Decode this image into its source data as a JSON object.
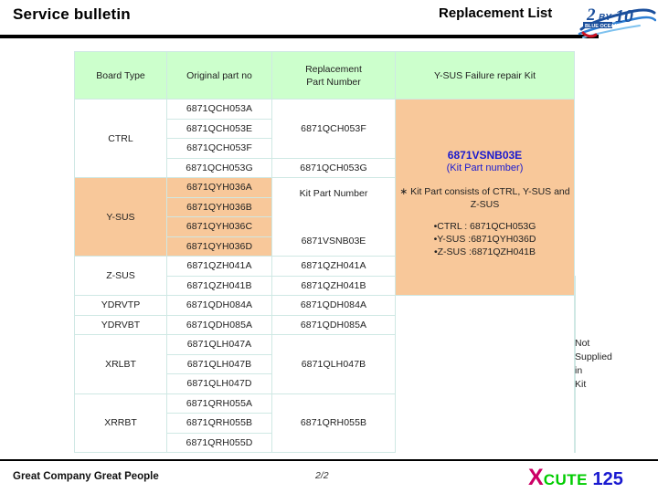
{
  "header": {
    "title": "Service bulletin",
    "subtitle": "Replacement List",
    "logo": {
      "number": "2",
      "by": "BY",
      "ten": "10",
      "tagline": "BLUE OCEAN"
    }
  },
  "table": {
    "columns": [
      "Board Type",
      "Original part no",
      "Replacement\nPart Number",
      "Y-SUS Failure repair Kit"
    ],
    "col_board_type": "Board Type",
    "col_original": "Original part no",
    "col_replacement_l1": "Replacement",
    "col_replacement_l2": "Part Number",
    "col_kit": "Y-SUS Failure repair Kit",
    "groups": [
      {
        "board_type": "CTRL",
        "highlight": false,
        "rows": [
          {
            "original": "6871QCH053A"
          },
          {
            "original": "6871QCH053E"
          },
          {
            "original": "6871QCH053F"
          },
          {
            "original": "6871QCH053G"
          }
        ],
        "replacements": [
          {
            "value": "6871QCH053F",
            "span": 3
          },
          {
            "value": "6871QCH053G",
            "span": 1
          }
        ]
      },
      {
        "board_type": "Y-SUS",
        "highlight": true,
        "rows": [
          {
            "original": "6871QYH036A"
          },
          {
            "original": "6871QYH036B"
          },
          {
            "original": "6871QYH036C"
          },
          {
            "original": "6871QYH036D"
          }
        ],
        "kit_label": "Kit Part Number",
        "kit_value": "6871VSNB03E"
      },
      {
        "board_type": "Z-SUS",
        "highlight": false,
        "rows": [
          {
            "original": "6871QZH041A",
            "replacement": "6871QZH041A"
          },
          {
            "original": "6871QZH041B",
            "replacement": "6871QZH041B"
          }
        ]
      },
      {
        "board_type": "YDRVTP",
        "highlight": false,
        "rows": [
          {
            "original": "6871QDH084A",
            "replacement": "6871QDH084A"
          }
        ]
      },
      {
        "board_type": "YDRVBT",
        "highlight": false,
        "rows": [
          {
            "original": "6871QDH085A",
            "replacement": "6871QDH085A"
          }
        ]
      },
      {
        "board_type": "XRLBT",
        "highlight": false,
        "rows": [
          {
            "original": "6871QLH047A"
          },
          {
            "original": "6871QLH047B"
          },
          {
            "original": "6871QLH047D"
          }
        ],
        "replacements": [
          {
            "value": "6871QLH047B",
            "span": 3
          }
        ]
      },
      {
        "board_type": "XRRBT",
        "highlight": false,
        "rows": [
          {
            "original": "6871QRH055A"
          },
          {
            "original": "6871QRH055B"
          },
          {
            "original": "6871QRH055D"
          }
        ],
        "replacements": [
          {
            "value": "6871QRH055B",
            "span": 3
          }
        ]
      }
    ],
    "kit_panel": {
      "kit_number": "6871VSNB03E",
      "kit_number_sub": "(Kit Part number)",
      "consists_note": "∗ Kit Part consists of CTRL, Y-SUS and Z-SUS",
      "items": [
        "•CTRL  : 6871QCH053G",
        "•Y-SUS :6871QYH036D",
        "•Z-SUS :6871QZH041B"
      ]
    },
    "not_supplied_l1": "Not Supplied",
    "not_supplied_l2": "in Kit"
  },
  "footer": {
    "company": "Great Company  Great People",
    "page": "2/2",
    "logo_x": "X",
    "logo_cute": "CUTE",
    "logo_num": "125"
  },
  "colors": {
    "header_green": "#ccffcc",
    "highlight_orange": "#f8c89a",
    "accent_blue": "#1a1ad0",
    "border": "#cfe8e4"
  }
}
